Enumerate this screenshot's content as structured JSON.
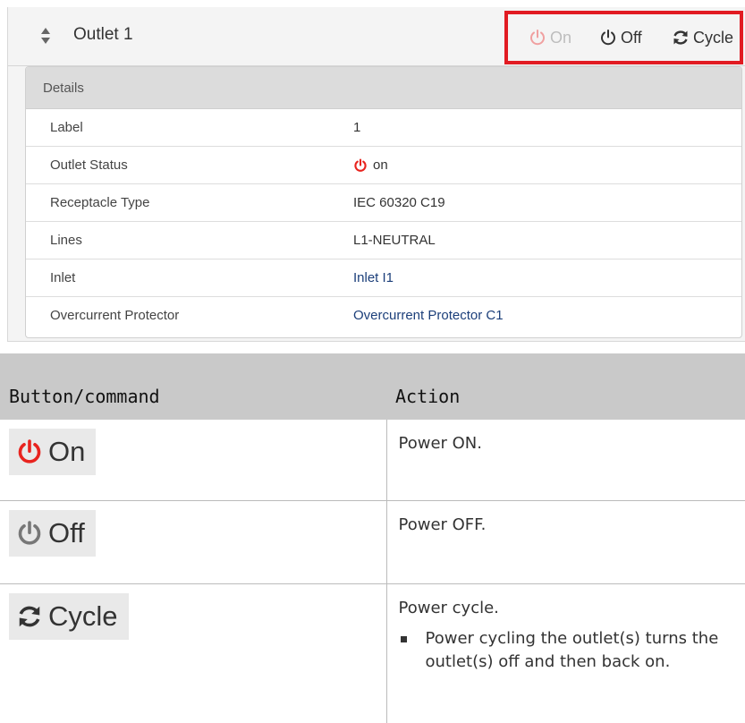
{
  "panel": {
    "title": "Outlet 1",
    "buttons": {
      "on": "On",
      "off": "Off",
      "cycle": "Cycle"
    },
    "highlight_color": "#e11b22",
    "details": {
      "heading": "Details",
      "rows": [
        {
          "label": "Label",
          "value": "1"
        },
        {
          "label": "Outlet Status",
          "value": "on",
          "icon": "power-icon"
        },
        {
          "label": "Receptacle Type",
          "value": "IEC 60320 C19"
        },
        {
          "label": "Lines",
          "value": "L1-NEUTRAL"
        },
        {
          "label": "Inlet",
          "value": "Inlet I1",
          "link": true
        },
        {
          "label": "Overcurrent Protector",
          "value": "Overcurrent Protector C1",
          "link": true
        }
      ]
    }
  },
  "doc_table": {
    "headers": [
      "Button/command",
      "Action"
    ],
    "rows": [
      {
        "command": "On",
        "icon": "power-icon-red",
        "action": "Power ON."
      },
      {
        "command": "Off",
        "icon": "power-icon-gray",
        "action": "Power OFF."
      },
      {
        "command": "Cycle",
        "icon": "cycle-icon",
        "action": "Power cycle.",
        "bullets": [
          "Power cycling the outlet(s) turns the outlet(s) off and then back on."
        ]
      }
    ]
  },
  "colors": {
    "power_on_red": "#e8231e",
    "power_off_gray": "#777777",
    "link_blue": "#1c3f7a"
  }
}
